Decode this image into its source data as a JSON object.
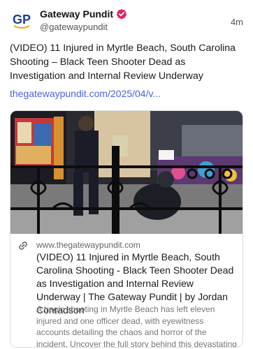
{
  "author": {
    "name": "Gateway Pundit",
    "handle": "@gatewaypundit",
    "avatar_text": "GP"
  },
  "time": "4m",
  "post": {
    "text": "(VIDEO) 11 Injured in Myrtle Beach, South Carolina Shooting – Black Teen Shooter Dead as Investigation and Internal Review Underway",
    "link": "thegatewaypundit.com/2025/04/v..."
  },
  "card": {
    "domain": "www.thegatewaypundit.com",
    "title": "(VIDEO) 11 Injured in Myrtle Beach, South Carolina Shooting - Black Teen Shooter Dead as Investigation and Internal Review Underway | The Gateway Pundit | by Jordan Conradson",
    "description": "A tragic shooting in Myrtle Beach has left eleven injured and one officer dead, with eyewitness accounts detailing the chaos and horror of the incident. Uncover the full story behind this devastating event."
  },
  "colors": {
    "link": "#4a63e6",
    "verified_badge": "#e0245e",
    "avatar_blue": "#1a3f8f"
  },
  "icons": {
    "verified": "verified-badge-icon",
    "link": "link-icon"
  }
}
